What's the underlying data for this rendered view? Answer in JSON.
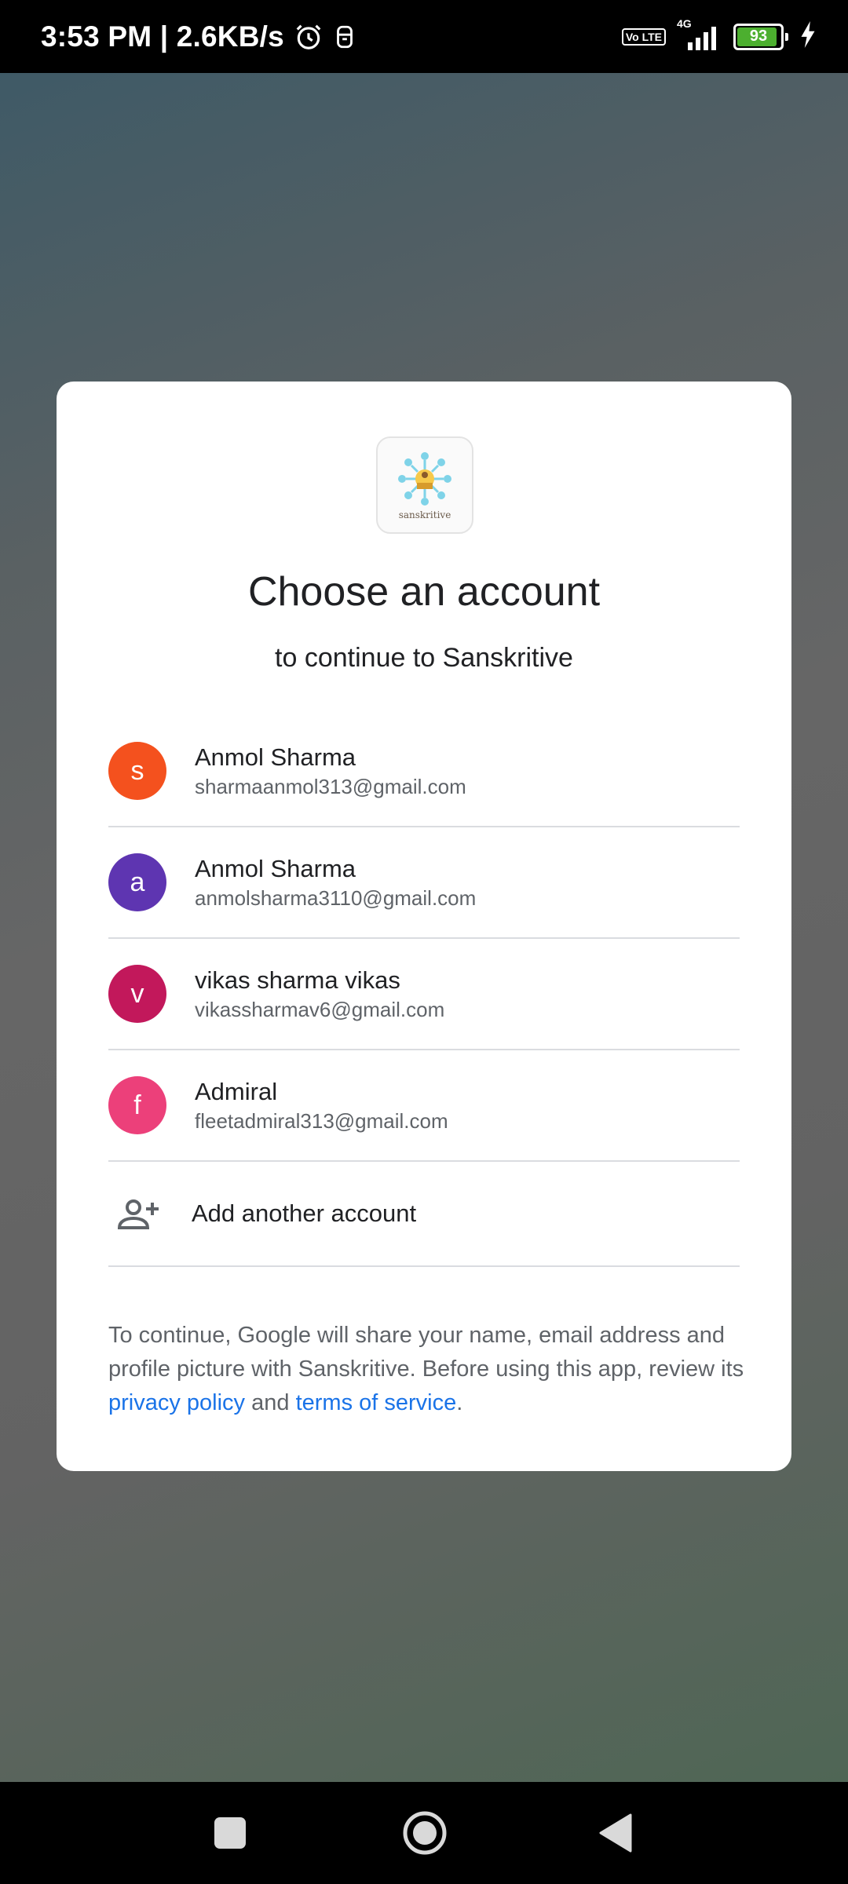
{
  "status_bar": {
    "time_speed": "3:53 PM | 2.6KB/s",
    "network_volte": "Vo LTE",
    "network_type": "4G",
    "battery": "93"
  },
  "dialog": {
    "app_logo_text": "sanskritive",
    "title": "Choose an account",
    "subtitle": "to continue to Sanskritive",
    "accounts": [
      {
        "initial": "s",
        "name": "Anmol Sharma",
        "email": "sharmaanmol313@gmail.com",
        "color": "#f4511e"
      },
      {
        "initial": "a",
        "name": "Anmol Sharma",
        "email": "anmolsharma3110@gmail.com",
        "color": "#5e35b1"
      },
      {
        "initial": "v",
        "name": "vikas sharma vikas",
        "email": "vikassharmav6@gmail.com",
        "color": "#c2185b"
      },
      {
        "initial": "f",
        "name": "Admiral",
        "email": "fleetadmiral313@gmail.com",
        "color": "#ec407a"
      }
    ],
    "add_account_label": "Add another account",
    "disclaimer": {
      "text_before": "To continue, Google will share your name, email address and profile picture with Sanskritive. Before using this app, review its ",
      "privacy_link": "privacy policy",
      "text_and": " and ",
      "terms_link": "terms of service",
      "text_after": "."
    }
  },
  "colors": {
    "link": "#1a73e8",
    "divider": "#dadce0",
    "battery_fill": "#4caf2f"
  }
}
